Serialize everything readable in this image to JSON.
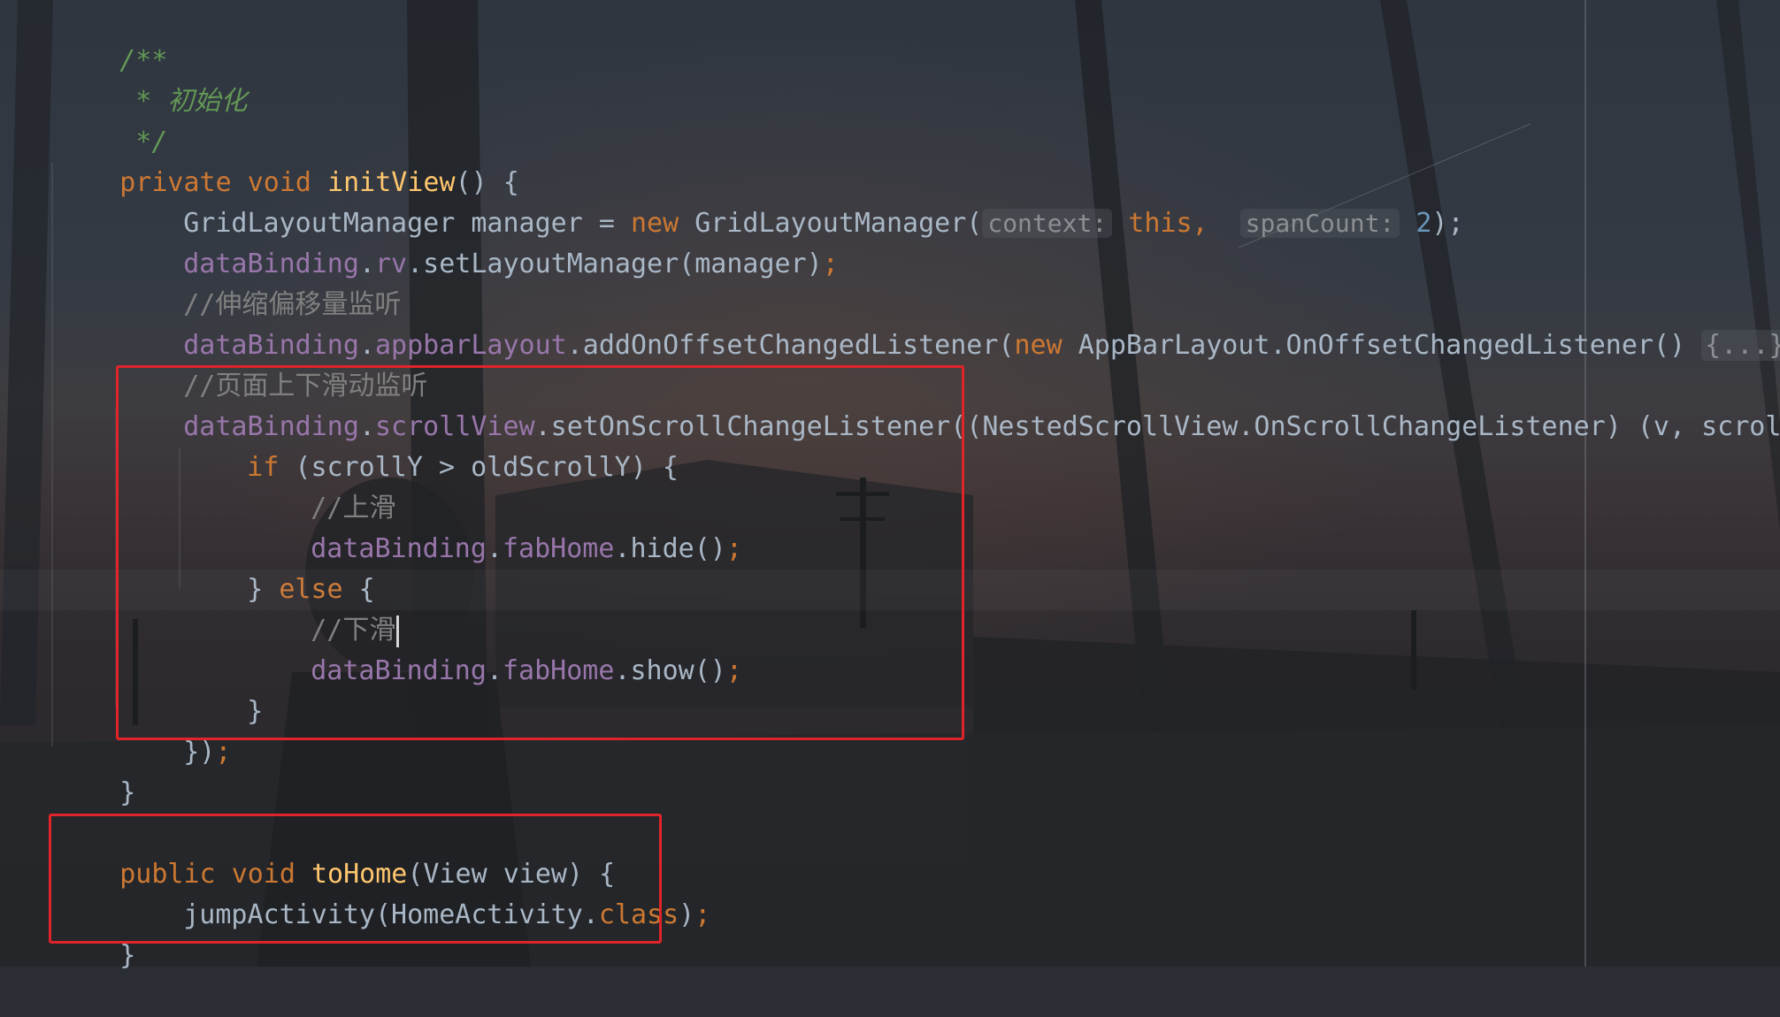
{
  "colors": {
    "keyword": "#cc7832",
    "method_decl": "#ffc66d",
    "field": "#9876aa",
    "number": "#6897bb",
    "comment": "#808080",
    "doc_comment": "#629755",
    "default_text": "#a9b7c6",
    "highlight_box": "#e0242a"
  },
  "code": {
    "l1": "/**",
    "l2": " * 初始化",
    "l3": " */",
    "l4": {
      "kw1": "private",
      "kw2": "void",
      "fn": "initView",
      "rest": "() {"
    },
    "l5": {
      "a": "GridLayoutManager manager = ",
      "kw": "new",
      "b": " GridLayoutManager(",
      "hint1": "context:",
      "this": "this",
      "comma": ",",
      "hint2": "spanCount:",
      "num": "2",
      "end": ");"
    },
    "l6": {
      "obj": "dataBinding",
      "dot": ".",
      "field": "rv",
      "call": ".setLayoutManager(manager)",
      "semi": ";"
    },
    "l7": "//伸缩偏移量监听",
    "l8": {
      "obj": "dataBinding",
      "dot": ".",
      "field": "appbarLayout",
      "call": ".addOnOffsetChangedListener(",
      "kw": "new",
      "cls": " AppBarLayout.OnOffsetChangedListener() ",
      "fold": "{...}",
      "end": ")",
      "semi": ";"
    },
    "l9": "//页面上下滑动监听",
    "l10": {
      "obj": "dataBinding",
      "dot": ".",
      "field": "scrollView",
      "call": ".setOnScrollChangeListener((NestedScrollView.OnScrollChangeListener) (v, scrollX, s"
    },
    "l11": {
      "kw": "if",
      "rest": " (scrollY > oldScrollY) {"
    },
    "l12": "//上滑",
    "l13": {
      "obj": "dataBinding",
      "dot": ".",
      "field": "fabHome",
      "call": ".hide()",
      "semi": ";"
    },
    "l14": {
      "open": "} ",
      "kw": "else",
      "rest": " {"
    },
    "l15": "//下滑",
    "l16": {
      "obj": "dataBinding",
      "dot": ".",
      "field": "fabHome",
      "call": ".show()",
      "semi": ";"
    },
    "l17": "}",
    "l18": {
      "a": "})",
      "semi": ";"
    },
    "l19": "}",
    "l21": {
      "kw1": "public",
      "kw2": "void",
      "fn": "toHome",
      "rest": "(View view) {"
    },
    "l22": {
      "a": "jumpActivity(HomeActivity.",
      "kw": "class",
      "b": ")",
      "semi": ";"
    },
    "l23": "}"
  }
}
